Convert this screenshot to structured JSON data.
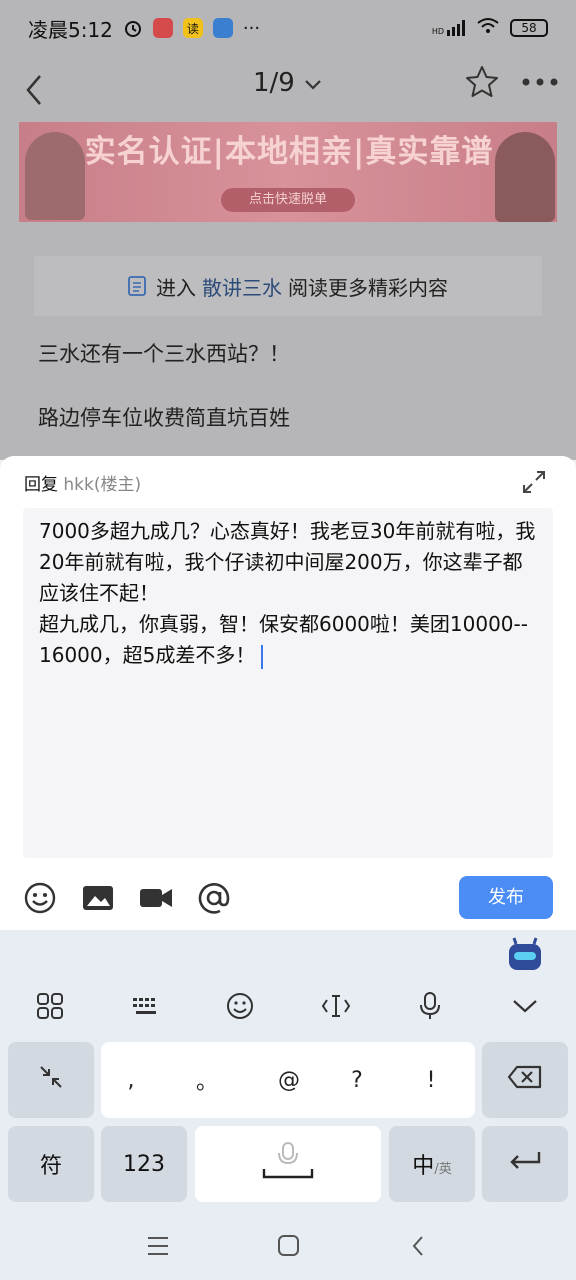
{
  "status_bar": {
    "time": "凌晨5:12",
    "battery": "58",
    "hd_label": "HD",
    "more": "···"
  },
  "nav": {
    "page_indicator": "1/9"
  },
  "banner": {
    "headline": "实名认证|本地相亲|真实靠谱",
    "button_label": "点击快速脱单"
  },
  "enter_forum": {
    "prefix": "进入",
    "forum_name": "散讲三水",
    "suffix": "阅读更多精彩内容"
  },
  "post_lines": [
    "三水还有一个三水西站？！",
    "路边停车位收费简直坑百姓"
  ],
  "reply": {
    "label": "回复",
    "username": "hkk(楼主)",
    "text": "7000多超九成几？心态真好！我老豆30年前就有啦，我20年前就有啦，我个仔读初中间屋200万，你这辈子都应该住不起！\n超九成几，你真弱，智！保安都6000啦！美团10000--16000，超5成差不多！",
    "publish_label": "发布"
  },
  "keyboard": {
    "punctuation": [
      ",",
      "。",
      "@",
      "?",
      "!"
    ],
    "symbols_label": "符",
    "numbers_label": "123",
    "lang_main": "中",
    "lang_alt": "/英"
  },
  "colors": {
    "accent": "#4b8cf5",
    "forum_link": "#2c4b78",
    "cursor": "#3a78f2"
  },
  "icons": [
    "back-arrow-icon",
    "chevron-down-icon",
    "star-icon",
    "more-icon",
    "collapse-icon",
    "emoji-icon",
    "image-icon",
    "video-icon",
    "at-icon",
    "grid-icon",
    "keyboard-icon",
    "cursor-move-icon",
    "microphone-icon",
    "hide-keyboard-icon",
    "backspace-icon",
    "enter-icon"
  ]
}
